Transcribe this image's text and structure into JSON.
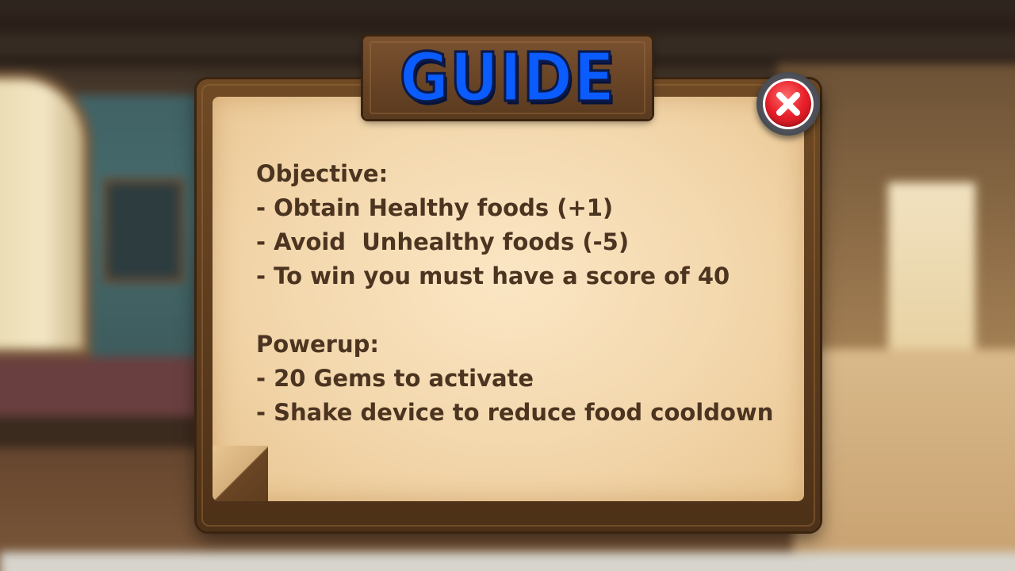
{
  "guide": {
    "title": "GUIDE",
    "objective": {
      "heading": "Objective:",
      "items": [
        "- Obtain Healthy foods (+1)",
        "- Avoid  Unhealthy foods (-5)",
        "- To win you must have a score of 40"
      ]
    },
    "powerup": {
      "heading": "Powerup:",
      "items": [
        "- 20 Gems to activate",
        "- Shake device to reduce food cooldown"
      ]
    }
  },
  "icons": {
    "close": "close-icon"
  },
  "colors": {
    "title": "#0a5cff",
    "text": "#4b3420",
    "close_button": "#e8202a",
    "panel_wood": "#5e3d1e",
    "parchment": "#f3d7ac"
  }
}
